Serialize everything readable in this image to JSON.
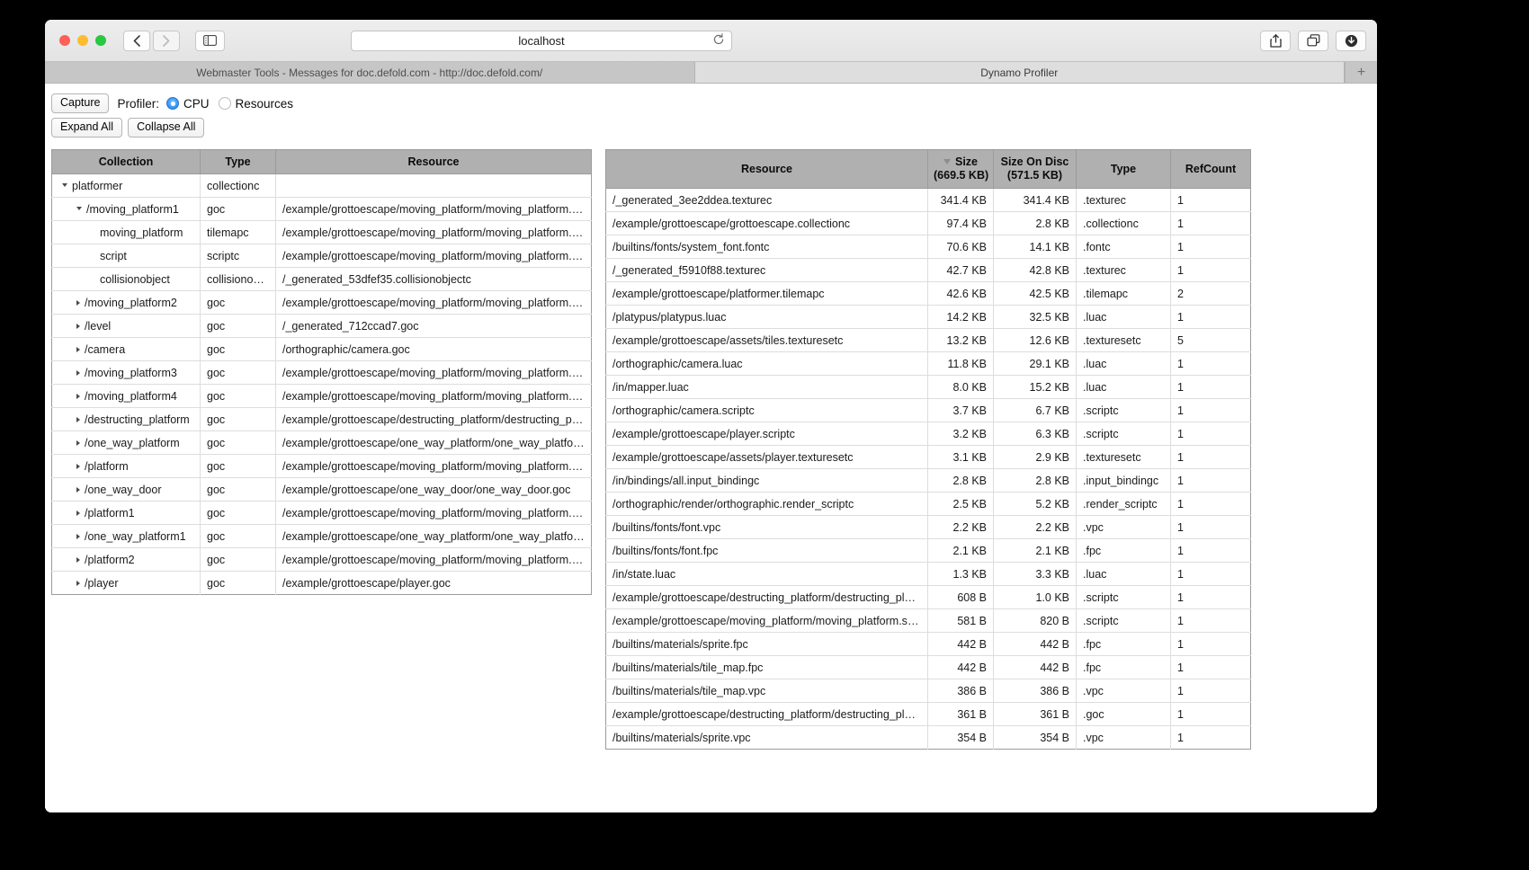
{
  "browser": {
    "url_value": "localhost",
    "reload_icon": "reload-icon",
    "back_icon": "chevron-left-icon",
    "forward_icon": "chevron-right-icon",
    "sidebar_icon": "sidebar-icon",
    "share_icon": "share-icon",
    "tabs_icon": "show-tabs-icon",
    "downloads_icon": "downloads-icon",
    "new_tab_label": "+",
    "tabs": [
      {
        "label": "Webmaster Tools - Messages for doc.defold.com - http://doc.defold.com/",
        "active": false
      },
      {
        "label": "Dynamo Profiler",
        "active": true
      }
    ]
  },
  "toolbar": {
    "capture_label": "Capture",
    "profiler_label": "Profiler:",
    "cpu_label": "CPU",
    "resources_label": "Resources",
    "expand_all_label": "Expand All",
    "collapse_all_label": "Collapse All",
    "selected_profiler": "CPU"
  },
  "left_table": {
    "headers": [
      "Collection",
      "Type",
      "Resource"
    ],
    "rows": [
      {
        "indent": 0,
        "twisty": "down",
        "leaf": false,
        "collection": "platformer",
        "type": "collectionc",
        "resource": ""
      },
      {
        "indent": 1,
        "twisty": "down",
        "leaf": false,
        "collection": "/moving_platform1",
        "type": "goc",
        "resource": "/example/grottoescape/moving_platform/moving_platform.goc"
      },
      {
        "indent": 2,
        "twisty": "none",
        "leaf": true,
        "collection": "moving_platform",
        "type": "tilemapc",
        "resource": "/example/grottoescape/moving_platform/moving_platform.tilemapc"
      },
      {
        "indent": 2,
        "twisty": "none",
        "leaf": true,
        "collection": "script",
        "type": "scriptc",
        "resource": "/example/grottoescape/moving_platform/moving_platform.scriptc"
      },
      {
        "indent": 2,
        "twisty": "none",
        "leaf": true,
        "collection": "collisionobject",
        "type": "collisionobjectc",
        "resource": "/_generated_53dfef35.collisionobjectc"
      },
      {
        "indent": 1,
        "twisty": "right",
        "leaf": false,
        "collection": "/moving_platform2",
        "type": "goc",
        "resource": "/example/grottoescape/moving_platform/moving_platform.goc"
      },
      {
        "indent": 1,
        "twisty": "right",
        "leaf": false,
        "collection": "/level",
        "type": "goc",
        "resource": "/_generated_712ccad7.goc"
      },
      {
        "indent": 1,
        "twisty": "right",
        "leaf": false,
        "collection": "/camera",
        "type": "goc",
        "resource": "/orthographic/camera.goc"
      },
      {
        "indent": 1,
        "twisty": "right",
        "leaf": false,
        "collection": "/moving_platform3",
        "type": "goc",
        "resource": "/example/grottoescape/moving_platform/moving_platform.goc"
      },
      {
        "indent": 1,
        "twisty": "right",
        "leaf": false,
        "collection": "/moving_platform4",
        "type": "goc",
        "resource": "/example/grottoescape/moving_platform/moving_platform.goc"
      },
      {
        "indent": 1,
        "twisty": "right",
        "leaf": false,
        "collection": "/destructing_platform",
        "type": "goc",
        "resource": "/example/grottoescape/destructing_platform/destructing_platform.goc"
      },
      {
        "indent": 1,
        "twisty": "right",
        "leaf": false,
        "collection": "/one_way_platform",
        "type": "goc",
        "resource": "/example/grottoescape/one_way_platform/one_way_platform.goc"
      },
      {
        "indent": 1,
        "twisty": "right",
        "leaf": false,
        "collection": "/platform",
        "type": "goc",
        "resource": "/example/grottoescape/moving_platform/moving_platform.goc"
      },
      {
        "indent": 1,
        "twisty": "right",
        "leaf": false,
        "collection": "/one_way_door",
        "type": "goc",
        "resource": "/example/grottoescape/one_way_door/one_way_door.goc"
      },
      {
        "indent": 1,
        "twisty": "right",
        "leaf": false,
        "collection": "/platform1",
        "type": "goc",
        "resource": "/example/grottoescape/moving_platform/moving_platform.goc"
      },
      {
        "indent": 1,
        "twisty": "right",
        "leaf": false,
        "collection": "/one_way_platform1",
        "type": "goc",
        "resource": "/example/grottoescape/one_way_platform/one_way_platform.goc"
      },
      {
        "indent": 1,
        "twisty": "right",
        "leaf": false,
        "collection": "/platform2",
        "type": "goc",
        "resource": "/example/grottoescape/moving_platform/moving_platform.goc"
      },
      {
        "indent": 1,
        "twisty": "right",
        "leaf": false,
        "collection": "/player",
        "type": "goc",
        "resource": "/example/grottoescape/player.goc"
      }
    ]
  },
  "right_table": {
    "headers": {
      "resource": "Resource",
      "size": "Size",
      "size_total": "(669.5 KB)",
      "size_on_disc": "Size On Disc",
      "size_on_disc_total": "(571.5 KB)",
      "type": "Type",
      "refcount": "RefCount"
    },
    "sorted_by": "Size",
    "sort_direction": "descending",
    "sort_icon": "sort-descending-icon",
    "rows": [
      {
        "resource": "/_generated_3ee2ddea.texturec",
        "size": "341.4 KB",
        "disc": "341.4 KB",
        "type": ".texturec",
        "ref": "1"
      },
      {
        "resource": "/example/grottoescape/grottoescape.collectionc",
        "size": "97.4 KB",
        "disc": "2.8 KB",
        "type": ".collectionc",
        "ref": "1"
      },
      {
        "resource": "/builtins/fonts/system_font.fontc",
        "size": "70.6 KB",
        "disc": "14.1 KB",
        "type": ".fontc",
        "ref": "1"
      },
      {
        "resource": "/_generated_f5910f88.texturec",
        "size": "42.7 KB",
        "disc": "42.8 KB",
        "type": ".texturec",
        "ref": "1"
      },
      {
        "resource": "/example/grottoescape/platformer.tilemapc",
        "size": "42.6 KB",
        "disc": "42.5 KB",
        "type": ".tilemapc",
        "ref": "2"
      },
      {
        "resource": "/platypus/platypus.luac",
        "size": "14.2 KB",
        "disc": "32.5 KB",
        "type": ".luac",
        "ref": "1"
      },
      {
        "resource": "/example/grottoescape/assets/tiles.texturesetc",
        "size": "13.2 KB",
        "disc": "12.6 KB",
        "type": ".texturesetc",
        "ref": "5"
      },
      {
        "resource": "/orthographic/camera.luac",
        "size": "11.8 KB",
        "disc": "29.1 KB",
        "type": ".luac",
        "ref": "1"
      },
      {
        "resource": "/in/mapper.luac",
        "size": "8.0 KB",
        "disc": "15.2 KB",
        "type": ".luac",
        "ref": "1"
      },
      {
        "resource": "/orthographic/camera.scriptc",
        "size": "3.7 KB",
        "disc": "6.7 KB",
        "type": ".scriptc",
        "ref": "1"
      },
      {
        "resource": "/example/grottoescape/player.scriptc",
        "size": "3.2 KB",
        "disc": "6.3 KB",
        "type": ".scriptc",
        "ref": "1"
      },
      {
        "resource": "/example/grottoescape/assets/player.texturesetc",
        "size": "3.1 KB",
        "disc": "2.9 KB",
        "type": ".texturesetc",
        "ref": "1"
      },
      {
        "resource": "/in/bindings/all.input_bindingc",
        "size": "2.8 KB",
        "disc": "2.8 KB",
        "type": ".input_bindingc",
        "ref": "1"
      },
      {
        "resource": "/orthographic/render/orthographic.render_scriptc",
        "size": "2.5 KB",
        "disc": "5.2 KB",
        "type": ".render_scriptc",
        "ref": "1"
      },
      {
        "resource": "/builtins/fonts/font.vpc",
        "size": "2.2 KB",
        "disc": "2.2 KB",
        "type": ".vpc",
        "ref": "1"
      },
      {
        "resource": "/builtins/fonts/font.fpc",
        "size": "2.1 KB",
        "disc": "2.1 KB",
        "type": ".fpc",
        "ref": "1"
      },
      {
        "resource": "/in/state.luac",
        "size": "1.3 KB",
        "disc": "3.3 KB",
        "type": ".luac",
        "ref": "1"
      },
      {
        "resource": "/example/grottoescape/destructing_platform/destructing_platform.scriptc",
        "size": "608 B",
        "disc": "1.0 KB",
        "type": ".scriptc",
        "ref": "1"
      },
      {
        "resource": "/example/grottoescape/moving_platform/moving_platform.scriptc",
        "size": "581 B",
        "disc": "820 B",
        "type": ".scriptc",
        "ref": "1"
      },
      {
        "resource": "/builtins/materials/sprite.fpc",
        "size": "442 B",
        "disc": "442 B",
        "type": ".fpc",
        "ref": "1"
      },
      {
        "resource": "/builtins/materials/tile_map.fpc",
        "size": "442 B",
        "disc": "442 B",
        "type": ".fpc",
        "ref": "1"
      },
      {
        "resource": "/builtins/materials/tile_map.vpc",
        "size": "386 B",
        "disc": "386 B",
        "type": ".vpc",
        "ref": "1"
      },
      {
        "resource": "/example/grottoescape/destructing_platform/destructing_platform.goc",
        "size": "361 B",
        "disc": "361 B",
        "type": ".goc",
        "ref": "1"
      },
      {
        "resource": "/builtins/materials/sprite.vpc",
        "size": "354 B",
        "disc": "354 B",
        "type": ".vpc",
        "ref": "1"
      }
    ]
  }
}
